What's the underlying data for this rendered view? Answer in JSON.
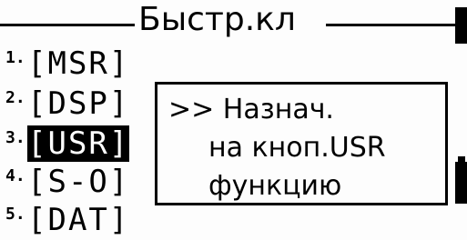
{
  "header": {
    "title": "Быстр.кл"
  },
  "menu": {
    "items": [
      {
        "num": "1.",
        "label": "[MSR]",
        "selected": false
      },
      {
        "num": "2.",
        "label": "[DSP]",
        "selected": false
      },
      {
        "num": "3.",
        "label": "[USR]",
        "selected": true
      },
      {
        "num": "4.",
        "label": "[S-O]",
        "selected": false
      },
      {
        "num": "5.",
        "label": "[DAT]",
        "selected": false
      }
    ]
  },
  "popup": {
    "line1": ">> Назнач.",
    "line2": "на кноп.USR",
    "line3": "функцию"
  }
}
